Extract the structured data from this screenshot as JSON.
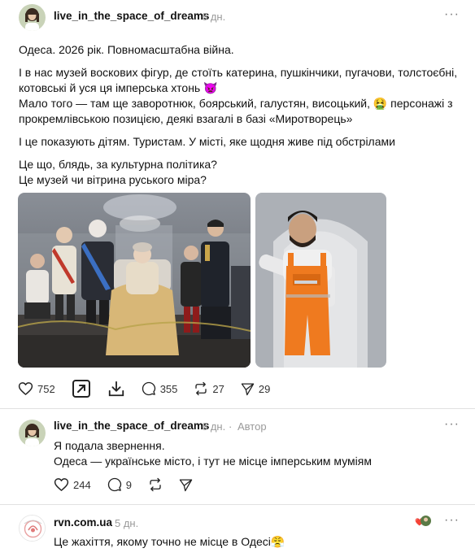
{
  "post": {
    "username": "live_in_the_space_of_dreams",
    "time": "6 дн.",
    "more": "···",
    "line1": "Одеса. 2026 рік. Повномасштабна війна.",
    "line2": "І в нас музей воскових фігур, де стоїть катерина, пушкінчики, пугачови, толстоєбні,",
    "line3": "котовські й уся ця імперська хтонь 👿",
    "line4a": "Мало того — там ще заворотнюк, боярський, галустян, висоцький, ",
    "line4_emoji": "🤮",
    "line4b": " персонажі з",
    "line5": "прокремлівською позицією, деякі взагалі в базі «Миротворець»",
    "line6": "І це показують дітям. Туристам. У місті, яке щодня живе під обстрілами",
    "line7": "Це що, блядь, за культурна політика?",
    "line8": "Це музей чи вітрина руського міра?",
    "likes": "752",
    "replies": "355",
    "reposts": "27",
    "shares": "29",
    "icons": [
      "heart-icon",
      "external-share-icon",
      "download-icon",
      "comment-icon",
      "repost-icon",
      "send-icon"
    ]
  },
  "reply": {
    "username": "live_in_the_space_of_dreams",
    "time": "6 дн.",
    "separator": "·",
    "author_label": "Автор",
    "more": "···",
    "line1": "Я подала звернення.",
    "line2": "Одеса — українське місто, і тут не місце імперським муміям",
    "likes": "244",
    "replies": "9"
  },
  "comment": {
    "username": "rvn.com.ua",
    "time": "5 дн.",
    "more": "···",
    "line1": "Це жахіття, якому точно не місце в Одесі",
    "emoji": "😤",
    "reaction_emoji": "❤️"
  },
  "colors": {
    "text": "#111111",
    "muted": "#9a9a9a",
    "divider": "#e1e1e1",
    "reaction_heart": "#e0245e"
  }
}
